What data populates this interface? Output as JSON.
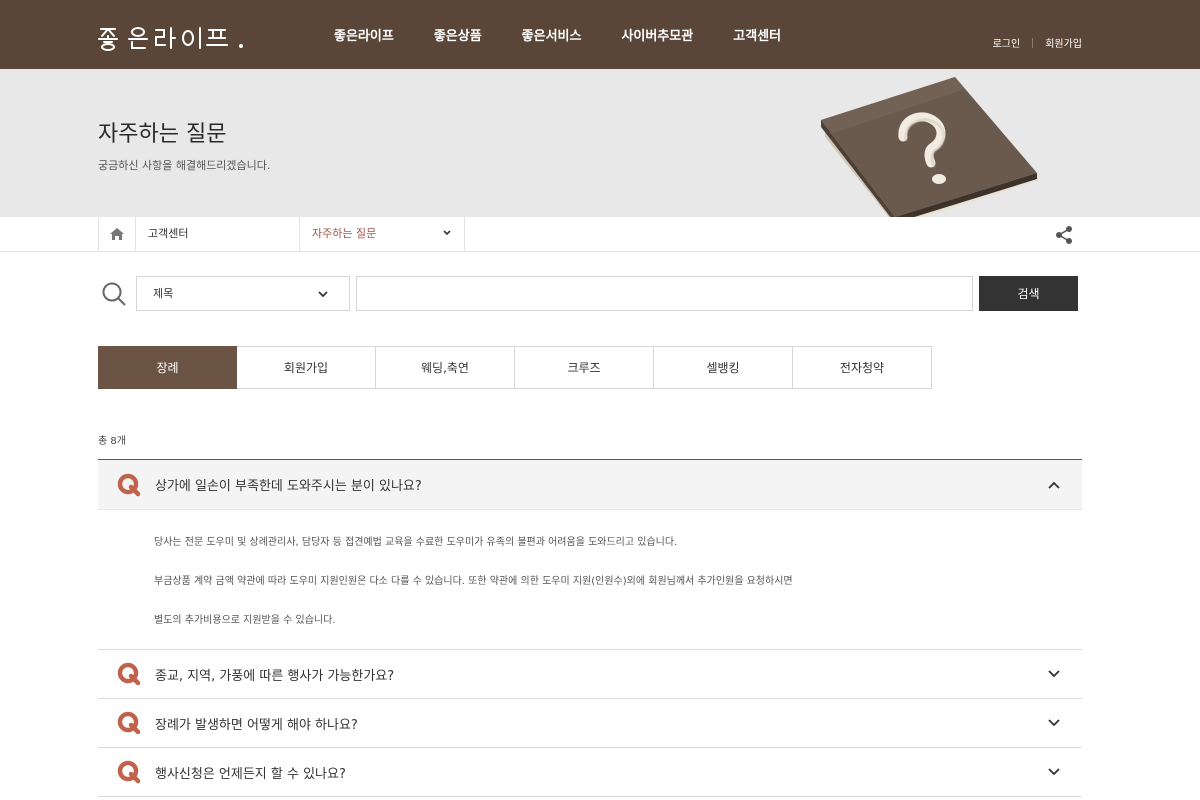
{
  "header": {
    "logo": "좋은라이프.",
    "nav": [
      "좋은라이프",
      "좋은상품",
      "좋은서비스",
      "사이버추모관",
      "고객센터"
    ],
    "login": "로그인",
    "join": "회원가입"
  },
  "visual": {
    "title": "자주하는 질문",
    "description": "궁금하신 사항을 해결해드리겠습니다."
  },
  "location": {
    "depth1": "고객센터",
    "depth2": "자주하는 질문"
  },
  "search": {
    "select_value": "제목",
    "input_value": "",
    "button_label": "검색"
  },
  "tabs": [
    {
      "label": "장례",
      "active": true
    },
    {
      "label": "회원가입",
      "active": false
    },
    {
      "label": "웨딩,축연",
      "active": false
    },
    {
      "label": "크루즈",
      "active": false
    },
    {
      "label": "셀뱅킹",
      "active": false
    },
    {
      "label": "전자청약",
      "active": false
    }
  ],
  "total": "총 8개",
  "faq": [
    {
      "question": "상가에 일손이 부족한데 도와주시는 분이 있나요?",
      "open": true,
      "answer": [
        "당사는 전문 도우미 및 상례관리사, 담당자 등 접견예법 교육을 수료한 도우미가 유족의 불편과 어려움을 도와드리고 있습니다.",
        "부금상품 계약 금액 약관에 따라 도우미 지원인원은 다소 다를 수 있습니다. 또한 약관에 의한 도우미 지원(인원수)외에 회원님께서 추가인원을 요청하시면",
        "별도의 추가비용으로 지원받을 수 있습니다."
      ]
    },
    {
      "question": "종교, 지역, 가풍에 따른 행사가 가능한가요?",
      "open": false
    },
    {
      "question": "장례가 발생하면 어떻게 해야 하나요?",
      "open": false
    },
    {
      "question": "행사신청은 언제든지 할 수 있나요?",
      "open": false
    }
  ],
  "colors": {
    "brand": "#5a4638",
    "tab_active": "#6b5444",
    "q_mark": "#c0624c",
    "location_active": "#a0574b",
    "search_button": "#333333"
  },
  "icons": [
    "home-icon",
    "chevron-down-icon",
    "share-icon",
    "search-icon",
    "q-icon",
    "chevron-up-icon",
    "question-book-image"
  ]
}
